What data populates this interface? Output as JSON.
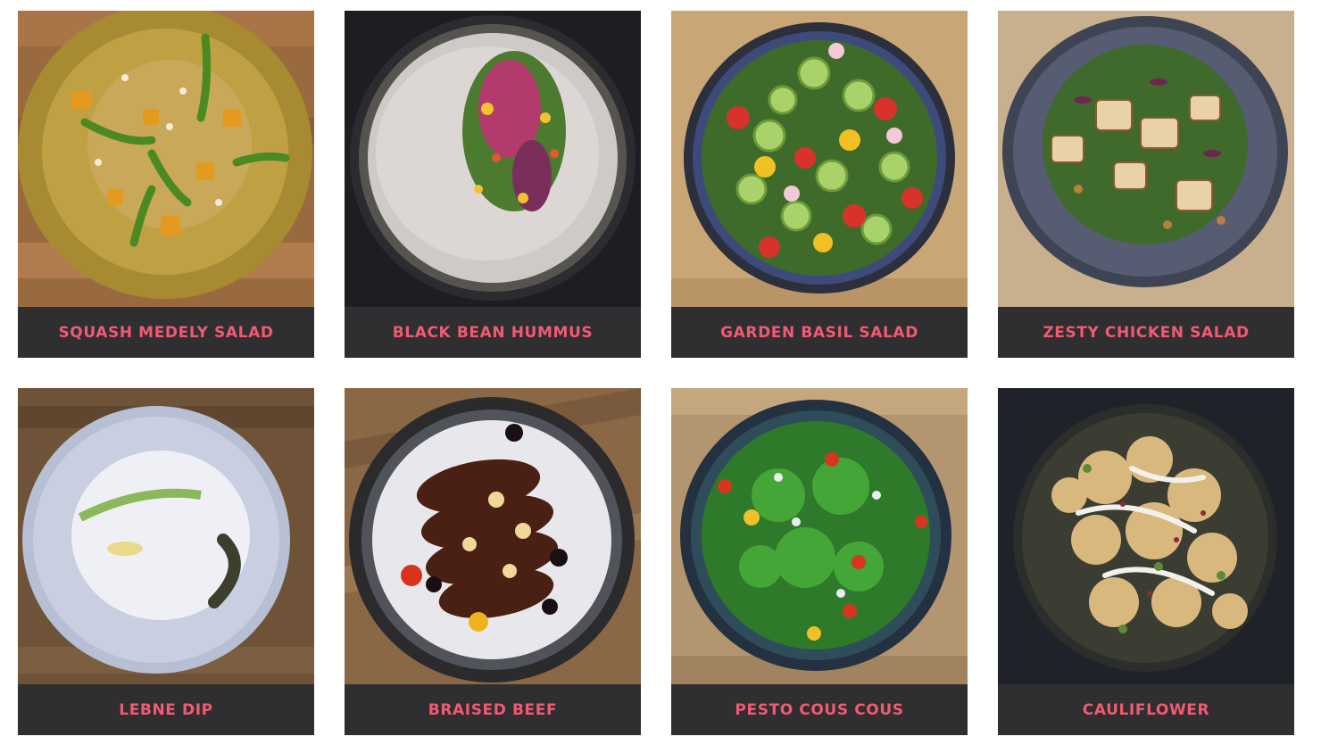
{
  "menu": {
    "items": [
      {
        "label": "SQUASH MEDELY SALAD"
      },
      {
        "label": "BLACK BEAN HUMMUS"
      },
      {
        "label": "GARDEN BASIL SALAD"
      },
      {
        "label": "ZESTY CHICKEN SALAD"
      },
      {
        "label": "LEBNE DIP"
      },
      {
        "label": "BRAISED BEEF"
      },
      {
        "label": "PESTO COUS COUS"
      },
      {
        "label": "CAULIFLOWER"
      }
    ]
  },
  "colors": {
    "caption_bg": "#2f2e30",
    "caption_text": "#f15a73"
  }
}
